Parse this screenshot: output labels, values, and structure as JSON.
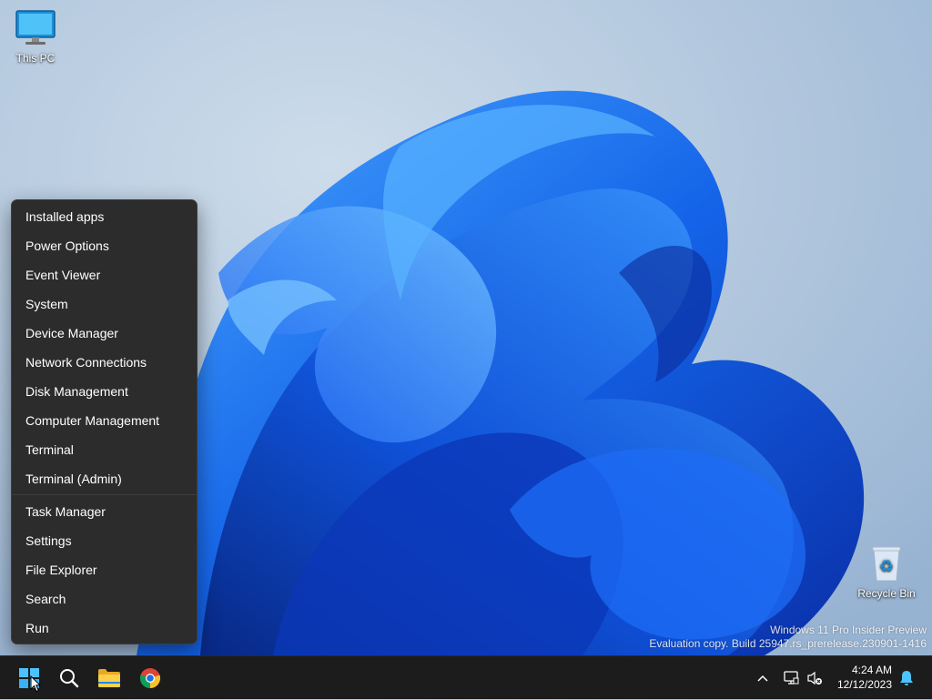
{
  "desktop": {
    "icons": [
      {
        "label": "This PC",
        "icon": "monitor-icon"
      },
      {
        "label": "Recycle Bin",
        "icon": "recycle-bin-icon"
      }
    ],
    "watermark": {
      "line1": "Windows 11 Pro Insider Preview",
      "line2": "Evaluation copy. Build 25947.rs_prerelease.230901-1416"
    }
  },
  "context_menu": {
    "group1": [
      "Installed apps",
      "Power Options",
      "Event Viewer",
      "System",
      "Device Manager",
      "Network Connections",
      "Disk Management",
      "Computer Management",
      "Terminal",
      "Terminal (Admin)"
    ],
    "group2": [
      "Task Manager",
      "Settings",
      "File Explorer",
      "Search",
      "Run"
    ]
  },
  "taskbar": {
    "pinned": [
      "windows-start-icon",
      "search-icon",
      "file-explorer-icon",
      "chrome-icon"
    ],
    "tray_icons": [
      "chevron-up-icon",
      "network-icon",
      "volume-muted-icon"
    ],
    "time": "4:24 AM",
    "date": "12/12/2023",
    "notification_icon": "bell-icon"
  },
  "colors": {
    "menu_bg": "#2c2c2c",
    "taskbar_bg": "#1c1c1c",
    "accent": "#0f6cbd"
  }
}
